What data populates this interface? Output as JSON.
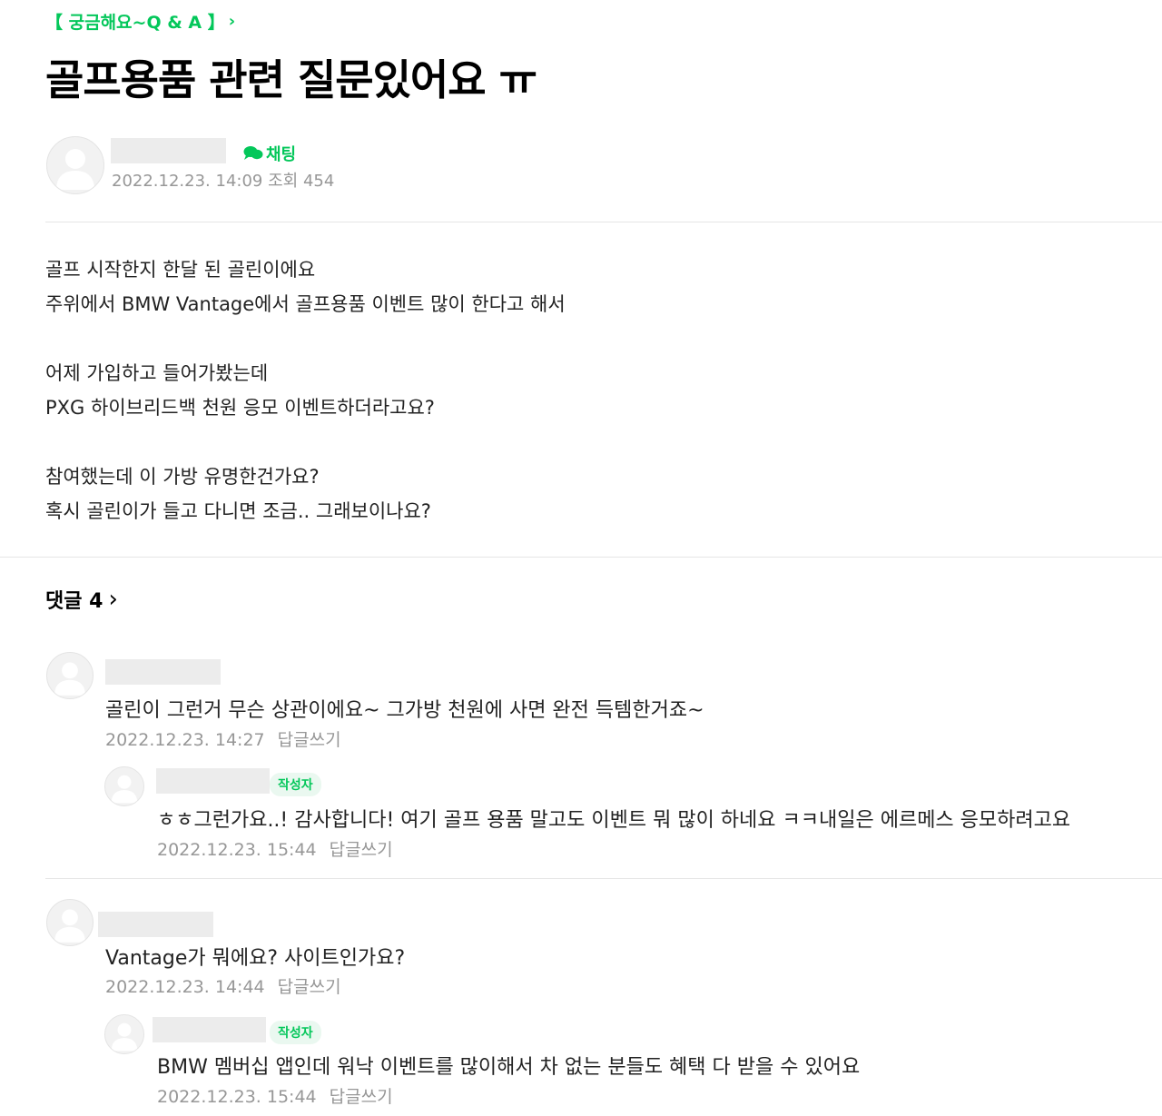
{
  "category": {
    "label": "【 궁금해요~Q & A 】",
    "chevron": "›"
  },
  "post": {
    "title": "골프용품 관련 질문있어요 ㅠ",
    "chat_label": "채팅",
    "date": "2022.12.23. 14:09",
    "views_label": "조회 454",
    "body": [
      "골프 시작한지 한달 된 골린이에요",
      "주위에서 BMW Vantage에서 골프용품 이벤트 많이 한다고 해서",
      "",
      "어제 가입하고 들어가봤는데",
      "PXG 하이브리드백 천원 응모 이벤트하더라고요?",
      "",
      "참여했는데 이 가방 유명한건가요?",
      "혹시 골린이가 들고 다니면 조금.. 그래보이나요?"
    ]
  },
  "comments_header": {
    "label": "댓글 4",
    "chevron": "›"
  },
  "reply_label": "답글쓰기",
  "author_badge": "작성자",
  "comments": [
    {
      "text": "골린이 그런거 무슨 상관이에요~ 그가방 천원에 사면 완전 득템한거죠~",
      "date": "2022.12.23. 14:27"
    },
    {
      "text": "ㅎㅎ그런가요..! 감사합니다! 여기 골프 용품 말고도 이벤트 뭐 많이 하네요 ㅋㅋ내일은 에르메스 응모하려고요",
      "date": "2022.12.23. 15:44"
    },
    {
      "text": "Vantage가 뭐에요? 사이트인가요?",
      "date": "2022.12.23. 14:44"
    },
    {
      "text": "BMW 멤버십 앱인데 워낙 이벤트를 많이해서 차 없는 분들도 혜택 다 받을 수 있어요",
      "date": "2022.12.23. 15:44"
    }
  ],
  "colors": {
    "accent": "#03c75a",
    "meta": "#979797",
    "divider": "#e6e6e6"
  }
}
